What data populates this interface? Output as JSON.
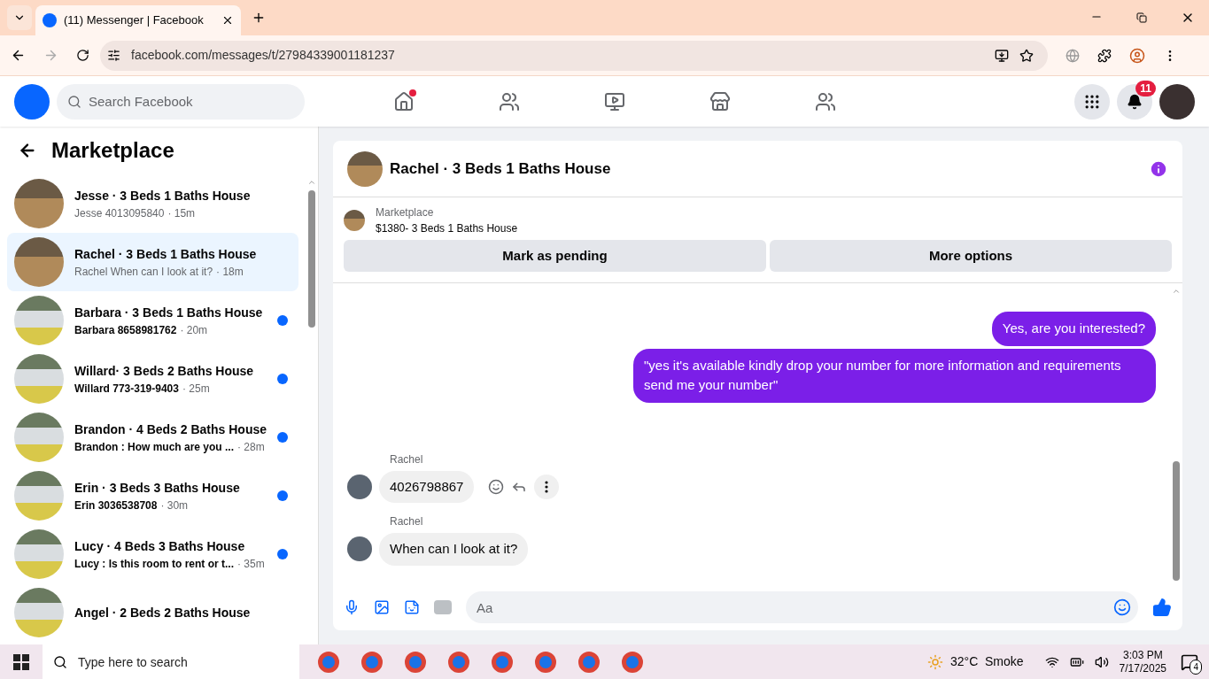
{
  "browser": {
    "tab_title": "(11) Messenger | Facebook",
    "url": "facebook.com/messages/t/27984339001181237"
  },
  "header": {
    "search_placeholder": "Search Facebook",
    "nav": [
      {
        "kind": "home",
        "badge": true
      },
      {
        "kind": "friends",
        "badge": false
      },
      {
        "kind": "video",
        "badge": false
      },
      {
        "kind": "marketplace",
        "badge": false
      },
      {
        "kind": "groups",
        "badge": false
      }
    ],
    "notification_count": "11"
  },
  "sidebar": {
    "title": "Marketplace",
    "items": [
      {
        "title": "Jesse · 3 Beds 1 Baths House",
        "preview": "Jesse 4013095840",
        "time": "· 15m",
        "selected": false,
        "unread": false
      },
      {
        "title": "Rachel · 3 Beds 1 Baths House",
        "preview": "Rachel When can I look at it?",
        "time": "· 18m",
        "selected": true,
        "unread": false
      },
      {
        "title": "Barbara · 3 Beds 1 Baths House",
        "preview": "Barbara 8658981762",
        "time": "· 20m",
        "selected": false,
        "unread": true
      },
      {
        "title": "Willard· 3 Beds 2 Baths House",
        "preview": "Willard 773-319-9403",
        "time": "· 25m",
        "selected": false,
        "unread": true
      },
      {
        "title": "Brandon · 4 Beds 2 Baths House",
        "preview": "Brandon : How much are you ...",
        "time": "· 28m",
        "selected": false,
        "unread": true
      },
      {
        "title": "Erin · 3 Beds 3 Baths House",
        "preview": "Erin 3036538708",
        "time": "· 30m",
        "selected": false,
        "unread": true
      },
      {
        "title": "Lucy · 4 Beds 3 Baths House",
        "preview": "Lucy : Is this room to rent or t...",
        "time": "· 35m",
        "selected": false,
        "unread": true
      },
      {
        "title": "Angel · 2 Beds 2 Baths House",
        "selected": false
      }
    ]
  },
  "chat": {
    "title": "Rachel · 3 Beds 1 Baths House",
    "listing": {
      "source": "Marketplace",
      "text": "$1380- 3 Beds 1 Baths House"
    },
    "actions": [
      "Mark as pending",
      "More options"
    ],
    "messages": [
      {
        "kind": "sent",
        "text": "Yes, are you interested?"
      },
      {
        "kind": "sent",
        "text": "\"yes it's available kindly drop your number for more information and requirements send me your number\""
      },
      {
        "kind": "received",
        "sender": "Rachel",
        "text": "4026798867",
        "hover_actions": true
      },
      {
        "kind": "received",
        "sender": "Rachel",
        "text": "When can I look at it?",
        "hover_actions": false
      }
    ],
    "composer_placeholder": "Aa"
  },
  "taskbar": {
    "search_placeholder": "Type here to search",
    "weather": "32°C  Smoke",
    "time": "3:03 PM",
    "date": "7/17/2025",
    "notifications": "4"
  }
}
